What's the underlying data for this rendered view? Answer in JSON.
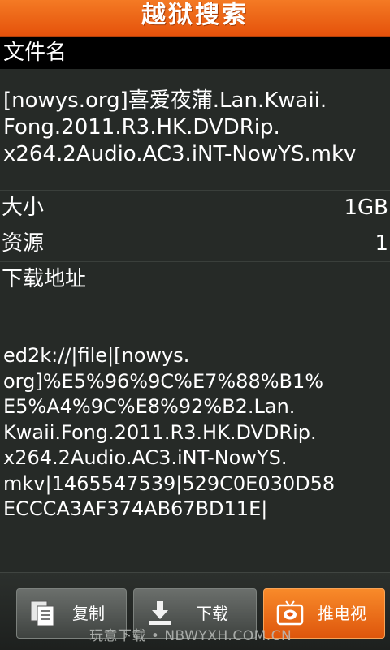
{
  "header": {
    "title": "越狱搜索"
  },
  "file": {
    "section_label": "文件名",
    "name": "[nowys.org]喜爱夜蒲.Lan.Kwaii.\nFong.2011.R3.HK.DVDRip.\nx264.2Audio.AC3.iNT-NowYS.mkv"
  },
  "details": {
    "size_label": "大小",
    "size_value": "1GB",
    "sources_label": "资源",
    "sources_value": "1",
    "link_label": "下载地址"
  },
  "link": {
    "text": "ed2k://|file|[nowys.\norg]%E5%96%9C%E7%88%B1%\nE5%A4%9C%E8%92%B2.Lan.\nKwaii.Fong.2011.R3.HK.DVDRip.\nx264.2Audio.AC3.iNT-NowYS.\nmkv|1465547539|529C0E030D58\nECCCA3AF374AB67BD11E|"
  },
  "toolbar": {
    "copy_label": "复制",
    "download_label": "下载",
    "push_tv_label": "推电视",
    "copy_icon": "copy-icon",
    "download_icon": "download-icon",
    "tv_icon": "tv-icon"
  },
  "watermark": "玩意下载 • NBWYXH.COM.CN",
  "colors": {
    "accent": "#e5520b",
    "background": "#262a27"
  }
}
